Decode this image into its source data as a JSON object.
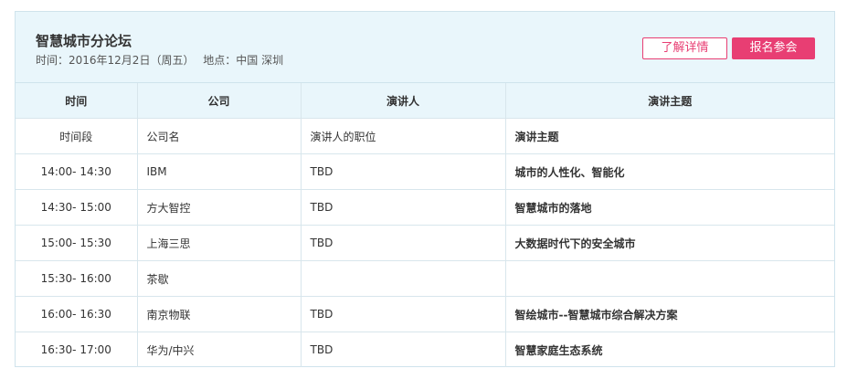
{
  "forum": {
    "title": "智慧城市分论坛",
    "time_text": "时间：2016年12月2日（周五）",
    "location_text": "地点：中国 深圳"
  },
  "buttons": {
    "details_label": "了解详情",
    "register_label": "报名参会"
  },
  "colors": {
    "accent": "#e83e73",
    "header_bg": "#e9f6fb",
    "border": "#d8e6ec"
  },
  "table": {
    "headers": [
      "时间",
      "公司",
      "演讲人",
      "演讲主题"
    ],
    "rows": [
      {
        "time": "时间段",
        "company": "公司名",
        "speaker": "演讲人的职位",
        "topic": "演讲主题"
      },
      {
        "time": "14:00- 14:30",
        "company": "IBM",
        "speaker": "TBD",
        "topic": "城市的人性化、智能化"
      },
      {
        "time": "14:30- 15:00",
        "company": "方大智控",
        "speaker": "TBD",
        "topic": "智慧城市的落地"
      },
      {
        "time": "15:00- 15:30",
        "company": "上海三思",
        "speaker": "TBD",
        "topic": "大数据时代下的安全城市"
      },
      {
        "time": "15:30- 16:00",
        "company": "茶歇",
        "speaker": "",
        "topic": ""
      },
      {
        "time": "16:00- 16:30",
        "company": "南京物联",
        "speaker": "TBD",
        "topic": "智绘城市--智慧城市综合解决方案"
      },
      {
        "time": "16:30- 17:00",
        "company": "华为/中兴",
        "speaker": "TBD",
        "topic": "智慧家庭生态系统"
      }
    ]
  }
}
